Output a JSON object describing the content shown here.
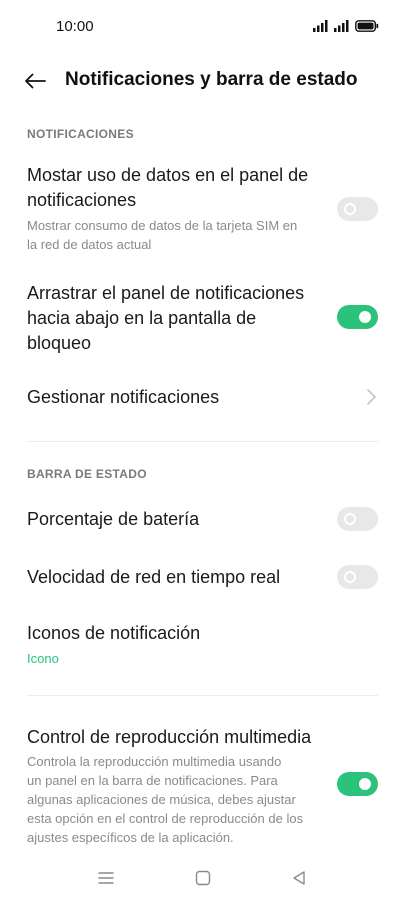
{
  "status_bar": {
    "time": "10:00",
    "icons": [
      "signal-icon",
      "signal-icon",
      "battery-icon"
    ]
  },
  "app_bar": {
    "title": "Notificaciones y barra de estado",
    "back_icon": "arrow-left-icon"
  },
  "sections": {
    "notifications_header": "NOTIFICACIONES",
    "status_bar_header": "BARRA DE ESTADO"
  },
  "settings": {
    "data_usage": {
      "title_line1": "Mostar uso de datos en el panel de",
      "title_line2": "notificaciones",
      "sub_line1": "Mostrar consumo de datos de la tarjeta SIM en",
      "sub_line2": "la red de datos actual",
      "enabled": false
    },
    "drag_panel": {
      "title_line1": "Arrastrar el panel de notificaciones",
      "title_line2": "hacia abajo en la pantalla de",
      "title_line3": "bloqueo",
      "enabled": true
    },
    "manage_notifications": {
      "title": "Gestionar notificaciones",
      "icon": "chevron-right-icon"
    },
    "battery_percentage": {
      "title": "Porcentaje de batería",
      "enabled": false
    },
    "network_speed": {
      "title": "Velocidad de red en tiempo real",
      "enabled": false
    },
    "notification_icons": {
      "title": "Iconos de notificación",
      "value": "Icono"
    },
    "media_control": {
      "title": "Control de reproducción multimedia",
      "sub_line1": "Controla la reproducción multimedia usando",
      "sub_line2": "un panel en la barra de notificaciones. Para",
      "sub_line3": "algunas aplicaciones de música, debes ajustar",
      "sub_line4": "esta opción en el control de reproducción de los",
      "sub_line5": "ajustes específicos de la aplicación.",
      "enabled": true
    }
  },
  "nav_bar": {
    "icons": [
      "menu-icon",
      "home-icon",
      "back-icon"
    ]
  },
  "colors": {
    "accent": "#2bc27a",
    "toggle_off": "#e8e8e8",
    "secondary_text": "#8a8a8a"
  }
}
